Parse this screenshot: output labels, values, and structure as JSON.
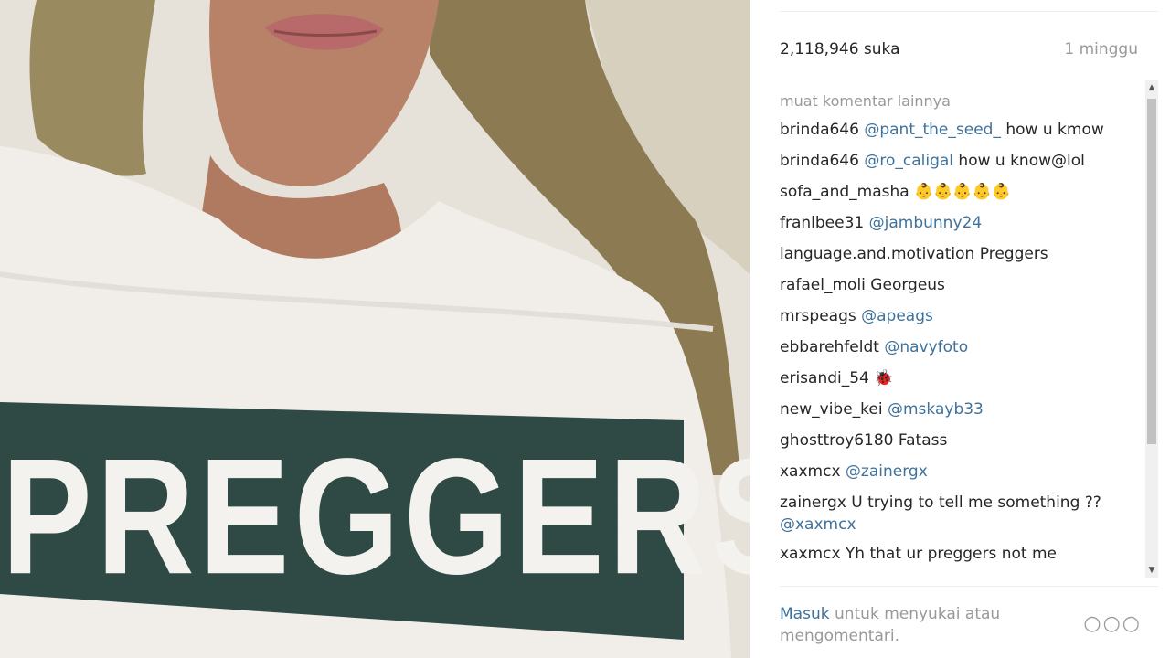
{
  "photo": {
    "shirt_text": "PREGGERS"
  },
  "post": {
    "likes": "2,118,946 suka",
    "time_ago": "1 minggu"
  },
  "comments": {
    "load_more": "muat komentar lainnya",
    "items": [
      {
        "user": "brinda646",
        "mention": "@pant_the_seed_",
        "text": " how u kmow"
      },
      {
        "user": "brinda646",
        "mention": "@ro_caligal",
        "text": " how u know@lol"
      },
      {
        "user": "sofa_and_masha",
        "mention": "",
        "text": " 👶👶👶👶👶"
      },
      {
        "user": "franlbee31",
        "mention": "@jambunny24",
        "text": ""
      },
      {
        "user": "language.and.motivation",
        "mention": "",
        "text": " Preggers"
      },
      {
        "user": "rafael_moli",
        "mention": "",
        "text": " Georgeus"
      },
      {
        "user": "mrspeags",
        "mention": "@apeags",
        "text": ""
      },
      {
        "user": "ebbarehfeldt",
        "mention": "@navyfoto",
        "text": ""
      },
      {
        "user": "erisandi_54",
        "mention": "",
        "text": " 🐞"
      },
      {
        "user": "new_vibe_kei",
        "mention": "@mskayb33",
        "text": ""
      },
      {
        "user": "ghosttroy6180",
        "mention": "",
        "text": " Fatass"
      },
      {
        "user": "xaxmcx",
        "mention": "@zainergx",
        "text": ""
      },
      {
        "user": "zainergx",
        "mention": "",
        "text": " U trying to tell me something ?? ",
        "mention_after": "@xaxmcx"
      },
      {
        "user": "xaxmcx",
        "mention": "",
        "text": " Yh that ur preggers not me"
      }
    ]
  },
  "footer": {
    "login_link": "Masuk",
    "login_text": " untuk menyukai atau mengomentari.",
    "more_icon": "more-options-icon"
  }
}
